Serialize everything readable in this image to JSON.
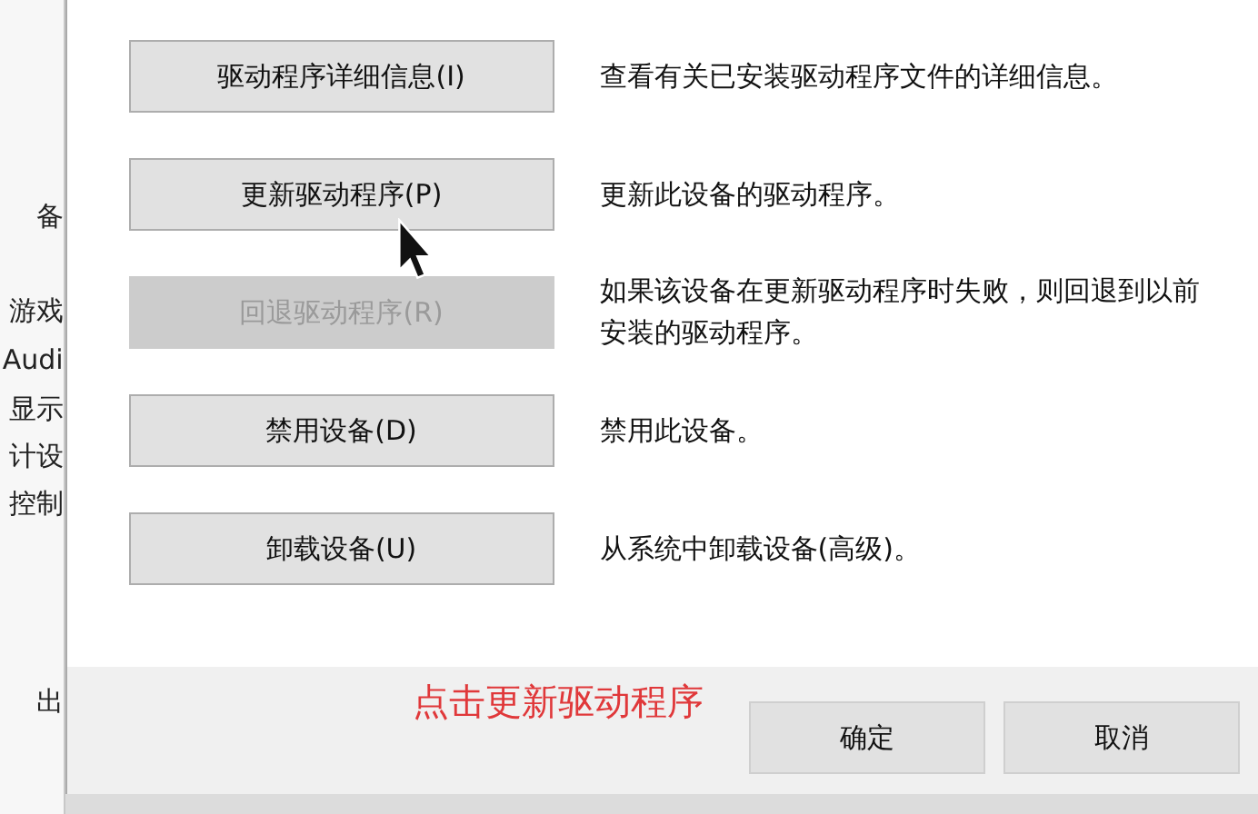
{
  "background_window": {
    "items": [
      "备",
      "游戏",
      "Audi",
      "显示",
      "计设",
      "控制",
      "出"
    ]
  },
  "actions": [
    {
      "button": "驱动程序详细信息(I)",
      "description": "查看有关已安装驱动程序文件的详细信息。",
      "disabled": false
    },
    {
      "button": "更新驱动程序(P)",
      "description": "更新此设备的驱动程序。",
      "disabled": false
    },
    {
      "button": "回退驱动程序(R)",
      "description": "如果该设备在更新驱动程序时失败，则回退到以前安装的驱动程序。",
      "disabled": true
    },
    {
      "button": "禁用设备(D)",
      "description": "禁用此设备。",
      "disabled": false
    },
    {
      "button": "卸载设备(U)",
      "description": "从系统中卸载设备(高级)。",
      "disabled": false
    }
  ],
  "caption": "点击更新驱动程序",
  "footer_buttons": [
    "确定",
    "取消"
  ]
}
